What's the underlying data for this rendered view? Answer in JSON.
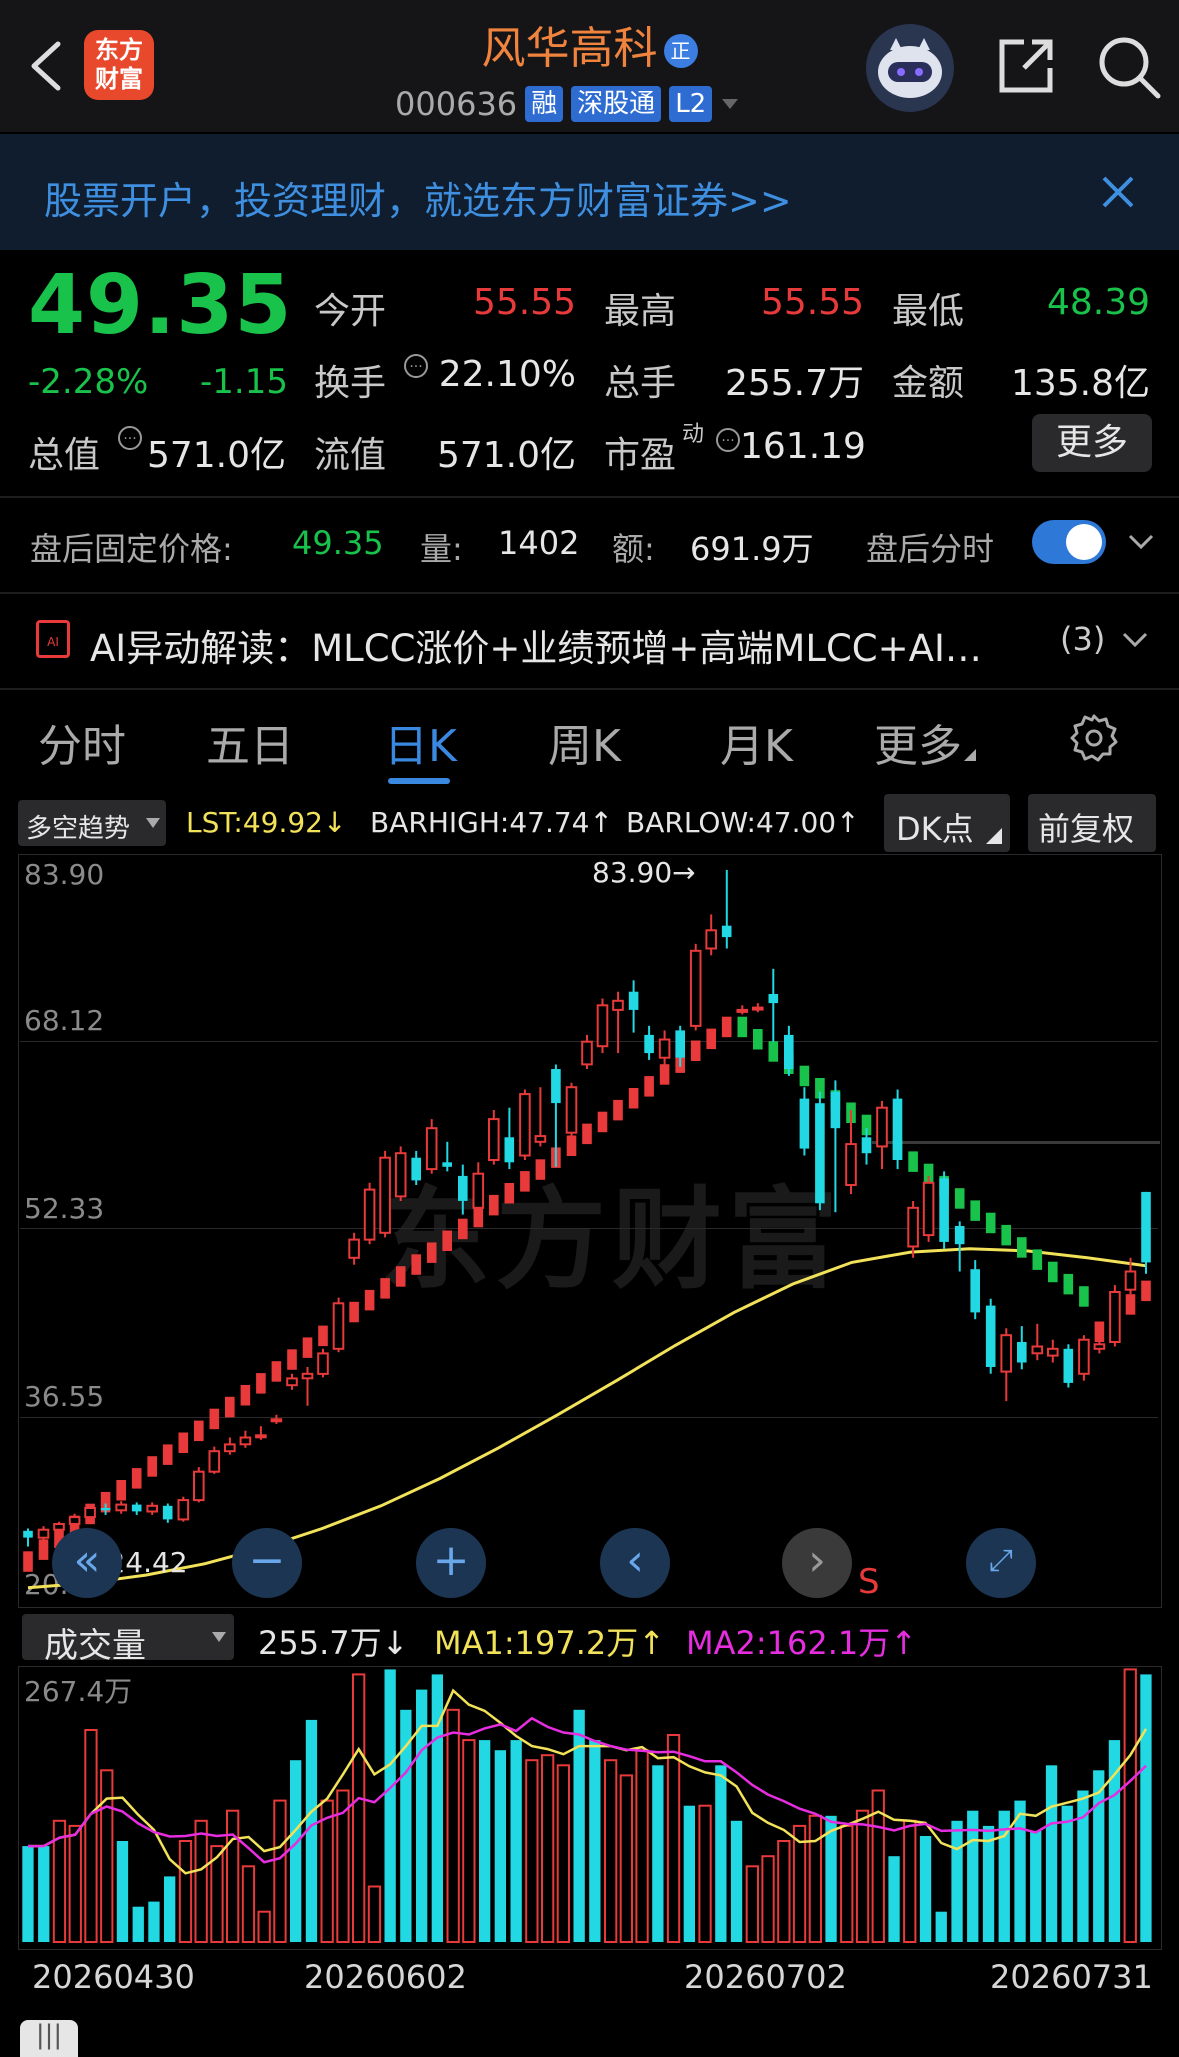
{
  "header": {
    "logo_text": "东方财富",
    "stock_name": "风华高科",
    "name_badge": "正",
    "stock_code": "000636",
    "tags": [
      "融",
      "深股通",
      "L2"
    ]
  },
  "banner": {
    "text": "股票开户，投资理财，就选东方财富证券>>"
  },
  "quote": {
    "price": "49.35",
    "change_pct": "-2.28%",
    "change": "-1.15",
    "open_label": "今开",
    "open": "55.55",
    "high_label": "最高",
    "high": "55.55",
    "low_label": "最低",
    "low": "48.39",
    "turnover_label": "换手",
    "turnover": "22.10%",
    "volume_label": "总手",
    "volume": "255.7万",
    "amount_label": "金额",
    "amount": "135.8亿",
    "mktcap_label": "总值",
    "mktcap": "571.0亿",
    "float_label": "流值",
    "float": "571.0亿",
    "pe_label": "市盈",
    "pe_sup": "动",
    "pe": "161.19",
    "more_label": "更多"
  },
  "after_hours": {
    "label": "盘后固定价格:",
    "price": "49.35",
    "vol_label": "量:",
    "vol": "1402",
    "amt_label": "额:",
    "amt": "691.9万",
    "toggle_label": "盘后分时",
    "toggle_on": true
  },
  "ai": {
    "icon_text": "AI",
    "text": "AI异动解读：MLCC涨价+业绩预增+高端MLCC+AI…",
    "count": "(3)"
  },
  "tabs": [
    "分时",
    "五日",
    "日K",
    "周K",
    "月K",
    "更多"
  ],
  "active_tab": 2,
  "kline_toolbar": {
    "indicator": "多空趋势",
    "lst": "LST:49.92↓",
    "barhigh": "BARHIGH:47.74↑",
    "barlow": "BARLOW:47.00↑",
    "dk_button": "DK点",
    "adjust_button": "前复权"
  },
  "price_chart": {
    "y_ticks": [
      "83.90",
      "68.12",
      "52.33",
      "36.55",
      "20.77"
    ],
    "high_marker": "83.90→",
    "low_marker": "←24.42",
    "signal": "S",
    "watermark": "东方财富"
  },
  "volume_toolbar": {
    "indicator": "成交量",
    "vol": "255.7万↓",
    "ma1": "MA1:197.2万↑",
    "ma2": "MA2:162.1万↑"
  },
  "volume_chart": {
    "max_label": "267.4万"
  },
  "x_dates": [
    "20260430",
    "20260602",
    "20260702",
    "20260731"
  ],
  "colors": {
    "up": "#e83a3a",
    "down": "#21d8e3",
    "accent": "#3b88e0",
    "ma_yellow": "#f2e25a",
    "ma_magenta": "#e62ee0",
    "dk_green": "#19c24a"
  },
  "chart_data": {
    "type": "candlestick",
    "y_range": [
      20.77,
      83.9
    ],
    "candles": [
      {
        "o": 25.8,
        "c": 25.2,
        "h": 26.0,
        "l": 24.42
      },
      {
        "o": 25.2,
        "c": 25.9,
        "h": 26.2,
        "l": 24.9
      },
      {
        "o": 25.9,
        "c": 26.4,
        "h": 26.6,
        "l": 25.6
      },
      {
        "o": 26.4,
        "c": 27.0,
        "h": 27.3,
        "l": 26.1
      },
      {
        "o": 27.0,
        "c": 27.8,
        "h": 28.1,
        "l": 26.8
      },
      {
        "o": 27.8,
        "c": 27.6,
        "h": 28.2,
        "l": 27.2
      },
      {
        "o": 27.6,
        "c": 28.1,
        "h": 28.4,
        "l": 27.3
      },
      {
        "o": 28.1,
        "c": 27.5,
        "h": 28.3,
        "l": 27.2
      },
      {
        "o": 27.5,
        "c": 28.0,
        "h": 28.3,
        "l": 27.2
      },
      {
        "o": 28.0,
        "c": 26.8,
        "h": 28.2,
        "l": 26.5
      },
      {
        "o": 26.8,
        "c": 28.5,
        "h": 28.8,
        "l": 26.6
      },
      {
        "o": 28.5,
        "c": 31.0,
        "h": 31.4,
        "l": 28.3
      },
      {
        "o": 31.0,
        "c": 32.8,
        "h": 33.2,
        "l": 30.8
      },
      {
        "o": 32.8,
        "c": 33.4,
        "h": 34.0,
        "l": 32.5
      },
      {
        "o": 33.4,
        "c": 34.0,
        "h": 34.6,
        "l": 33.1
      },
      {
        "o": 34.2,
        "c": 34.2,
        "h": 35.0,
        "l": 33.8
      },
      {
        "o": 35.6,
        "c": 35.6,
        "h": 36.0,
        "l": 35.2
      },
      {
        "o": 38.6,
        "c": 39.2,
        "h": 39.6,
        "l": 38.2
      },
      {
        "o": 39.2,
        "c": 39.6,
        "h": 40.2,
        "l": 36.8
      },
      {
        "o": 39.6,
        "c": 41.4,
        "h": 41.8,
        "l": 39.3
      },
      {
        "o": 41.8,
        "c": 45.8,
        "h": 46.3,
        "l": 41.5
      },
      {
        "o": 49.8,
        "c": 51.4,
        "h": 52.0,
        "l": 49.2
      },
      {
        "o": 51.4,
        "c": 55.8,
        "h": 56.4,
        "l": 51.0
      },
      {
        "o": 52.0,
        "c": 58.6,
        "h": 59.2,
        "l": 51.6
      },
      {
        "o": 55.2,
        "c": 59.0,
        "h": 59.6,
        "l": 54.8
      },
      {
        "o": 58.6,
        "c": 56.6,
        "h": 59.2,
        "l": 56.2
      },
      {
        "o": 57.6,
        "c": 61.2,
        "h": 62.0,
        "l": 57.2
      },
      {
        "o": 58.2,
        "c": 57.8,
        "h": 60.0,
        "l": 57.4
      },
      {
        "o": 57.0,
        "c": 54.8,
        "h": 58.0,
        "l": 53.6
      },
      {
        "o": 54.2,
        "c": 57.2,
        "h": 58.2,
        "l": 53.8
      },
      {
        "o": 58.4,
        "c": 62.0,
        "h": 62.8,
        "l": 58.0
      },
      {
        "o": 60.4,
        "c": 58.2,
        "h": 63.0,
        "l": 57.6
      },
      {
        "o": 58.8,
        "c": 64.2,
        "h": 64.6,
        "l": 58.4
      },
      {
        "o": 60.0,
        "c": 60.5,
        "h": 64.8,
        "l": 59.6
      },
      {
        "o": 66.4,
        "c": 63.4,
        "h": 66.8,
        "l": 57.8
      },
      {
        "o": 60.8,
        "c": 64.8,
        "h": 65.2,
        "l": 60.4
      },
      {
        "o": 66.8,
        "c": 68.8,
        "h": 69.4,
        "l": 66.4
      },
      {
        "o": 68.4,
        "c": 72.0,
        "h": 72.6,
        "l": 67.8
      },
      {
        "o": 71.6,
        "c": 72.4,
        "h": 73.2,
        "l": 67.8
      },
      {
        "o": 73.2,
        "c": 71.6,
        "h": 74.2,
        "l": 69.6
      },
      {
        "o": 69.4,
        "c": 67.8,
        "h": 70.2,
        "l": 67.2
      },
      {
        "o": 67.4,
        "c": 69.0,
        "h": 69.8,
        "l": 65.2
      },
      {
        "o": 69.8,
        "c": 67.4,
        "h": 70.2,
        "l": 66.6
      },
      {
        "o": 70.2,
        "c": 76.8,
        "h": 77.4,
        "l": 69.8
      },
      {
        "o": 77.0,
        "c": 78.6,
        "h": 80.0,
        "l": 76.4
      },
      {
        "o": 79.0,
        "c": 78.0,
        "h": 83.9,
        "l": 77.0
      },
      {
        "o": 71.6,
        "c": 71.6,
        "h": 72.0,
        "l": 71.2
      },
      {
        "o": 71.8,
        "c": 71.8,
        "h": 72.2,
        "l": 71.4
      },
      {
        "o": 73.0,
        "c": 72.2,
        "h": 75.2,
        "l": 68.8
      },
      {
        "o": 69.4,
        "c": 66.4,
        "h": 70.2,
        "l": 65.8
      },
      {
        "o": 63.8,
        "c": 59.4,
        "h": 64.8,
        "l": 58.8
      },
      {
        "o": 63.4,
        "c": 54.6,
        "h": 64.4,
        "l": 54.0
      },
      {
        "o": 64.4,
        "c": 61.2,
        "h": 65.4,
        "l": 53.8
      },
      {
        "o": 56.2,
        "c": 59.8,
        "h": 62.8,
        "l": 55.4
      },
      {
        "o": 60.4,
        "c": 59.0,
        "h": 61.2,
        "l": 58.0
      },
      {
        "o": 59.6,
        "c": 63.0,
        "h": 63.6,
        "l": 57.6
      },
      {
        "o": 63.8,
        "c": 58.4,
        "h": 64.6,
        "l": 57.6
      },
      {
        "o": 50.8,
        "c": 54.2,
        "h": 54.8,
        "l": 49.8
      },
      {
        "o": 51.8,
        "c": 56.4,
        "h": 57.0,
        "l": 51.2
      },
      {
        "o": 56.8,
        "c": 51.2,
        "h": 57.4,
        "l": 50.6
      },
      {
        "o": 52.6,
        "c": 51.0,
        "h": 53.0,
        "l": 48.6
      },
      {
        "o": 48.8,
        "c": 45.0,
        "h": 49.6,
        "l": 44.4
      },
      {
        "o": 45.6,
        "c": 40.2,
        "h": 46.2,
        "l": 39.6
      },
      {
        "o": 39.8,
        "c": 43.0,
        "h": 43.6,
        "l": 37.2
      },
      {
        "o": 42.4,
        "c": 40.6,
        "h": 43.8,
        "l": 40.0
      },
      {
        "o": 41.4,
        "c": 42.0,
        "h": 44.0,
        "l": 40.8
      },
      {
        "o": 41.2,
        "c": 41.8,
        "h": 42.6,
        "l": 40.6
      },
      {
        "o": 41.8,
        "c": 38.8,
        "h": 42.2,
        "l": 38.4
      },
      {
        "o": 39.6,
        "c": 42.6,
        "h": 43.0,
        "l": 39.0
      },
      {
        "o": 41.8,
        "c": 42.2,
        "h": 42.8,
        "l": 41.4
      },
      {
        "o": 42.4,
        "c": 46.8,
        "h": 47.4,
        "l": 42.0
      },
      {
        "o": 47.0,
        "c": 48.6,
        "h": 49.8,
        "l": 46.6
      },
      {
        "o": 55.6,
        "c": 49.4,
        "h": 55.6,
        "l": 48.4
      }
    ],
    "ma_line": [
      20.8,
      21.2,
      21.9,
      22.9,
      24.3,
      26.0,
      28.0,
      30.4,
      33.1,
      36.0,
      39.0,
      42.1,
      45.0,
      47.5,
      49.4,
      50.3,
      50.6,
      50.4,
      49.8,
      49.1
    ],
    "volume_max": 267.4,
    "volumes": [
      95,
      95,
      120,
      115,
      210,
      170,
      100,
      35,
      40,
      65,
      100,
      120,
      95,
      130,
      75,
      30,
      140,
      180,
      220,
      140,
      150,
      265,
      55,
      270,
      230,
      250,
      265,
      230,
      200,
      200,
      190,
      200,
      180,
      185,
      175,
      230,
      200,
      180,
      165,
      190,
      175,
      205,
      135,
      135,
      175,
      120,
      75,
      85,
      100,
      115,
      125,
      125,
      115,
      130,
      150,
      85,
      120,
      105,
      30,
      120,
      130,
      115,
      130,
      140,
      110,
      175,
      135,
      150,
      170,
      200,
      270,
      265
    ]
  }
}
